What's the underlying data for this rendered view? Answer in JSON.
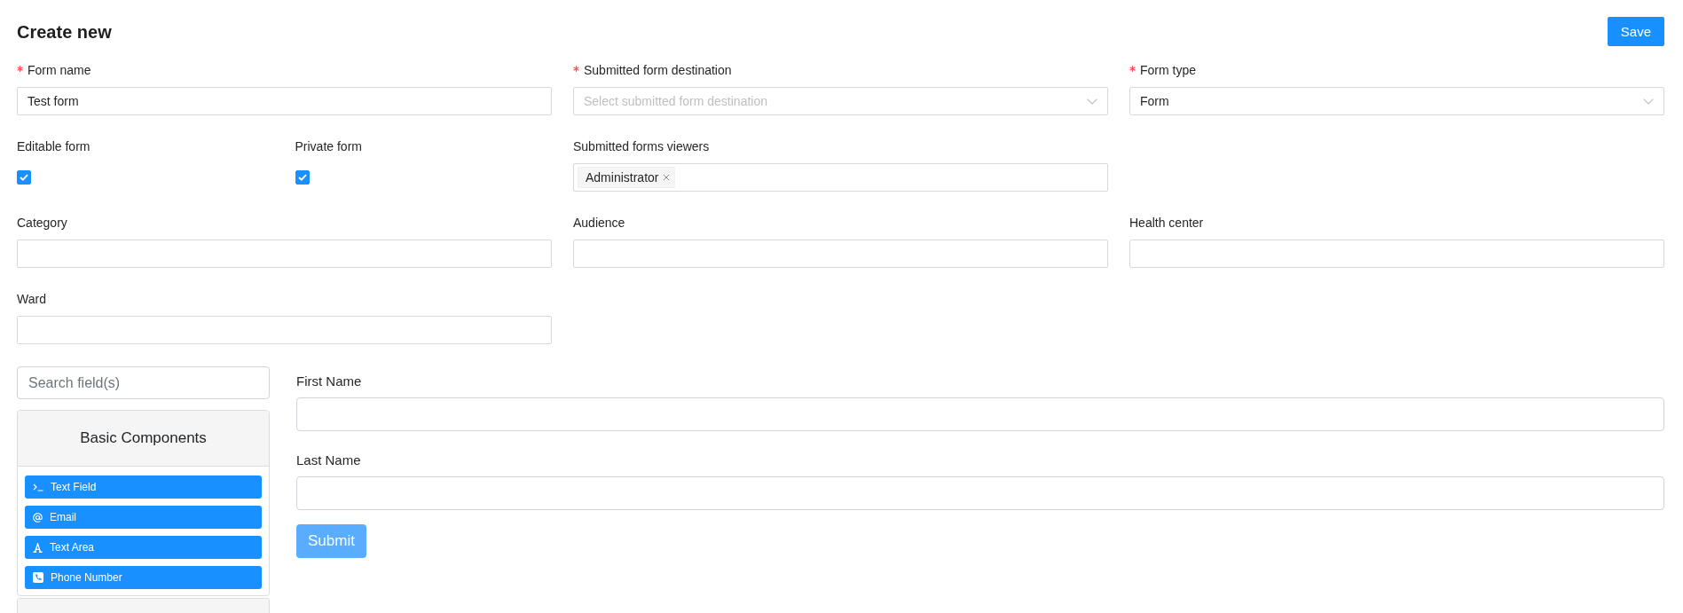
{
  "header": {
    "title": "Create new",
    "save_button": "Save"
  },
  "form_settings": {
    "rows": [
      [
        {
          "kind": "text",
          "label": "Form name",
          "required": true,
          "value": "Test form"
        },
        {
          "kind": "select",
          "label": "Submitted form destination",
          "required": true,
          "placeholder": "Select submitted form destination"
        },
        {
          "kind": "select",
          "label": "Form type",
          "required": true,
          "value": "Form"
        }
      ],
      [
        {
          "kind": "checkbox_pair",
          "fields": [
            {
              "kind": "checkbox",
              "label": "Editable form",
              "required": false,
              "checked": true
            },
            {
              "kind": "checkbox",
              "label": "Private form",
              "required": false,
              "checked": true
            }
          ]
        },
        {
          "kind": "tags",
          "label": "Submitted forms viewers",
          "required": false,
          "tags": [
            "Administrator"
          ]
        }
      ],
      [
        {
          "kind": "text",
          "label": "Category",
          "required": false
        },
        {
          "kind": "text",
          "label": "Audience",
          "required": false
        },
        {
          "kind": "text",
          "label": "Health center",
          "required": false
        }
      ],
      [
        {
          "kind": "text",
          "label": "Ward",
          "required": false
        }
      ]
    ]
  },
  "component_search": {
    "placeholder": "Search field(s)"
  },
  "component_groups": [
    {
      "title": "Basic Components",
      "expanded": true,
      "components": [
        {
          "kind": "textfield",
          "label": "Text Field"
        },
        {
          "kind": "email",
          "label": "Email"
        },
        {
          "kind": "textarea",
          "label": "Text Area"
        },
        {
          "kind": "phone",
          "label": "Phone Number"
        }
      ]
    },
    {
      "expanded": false
    }
  ],
  "form_preview": {
    "fields": [
      {
        "kind": "textfield",
        "label": "First Name"
      },
      {
        "kind": "textfield",
        "label": "Last Name"
      }
    ],
    "submit_button": {
      "label": "Submit",
      "disabled": true
    }
  }
}
